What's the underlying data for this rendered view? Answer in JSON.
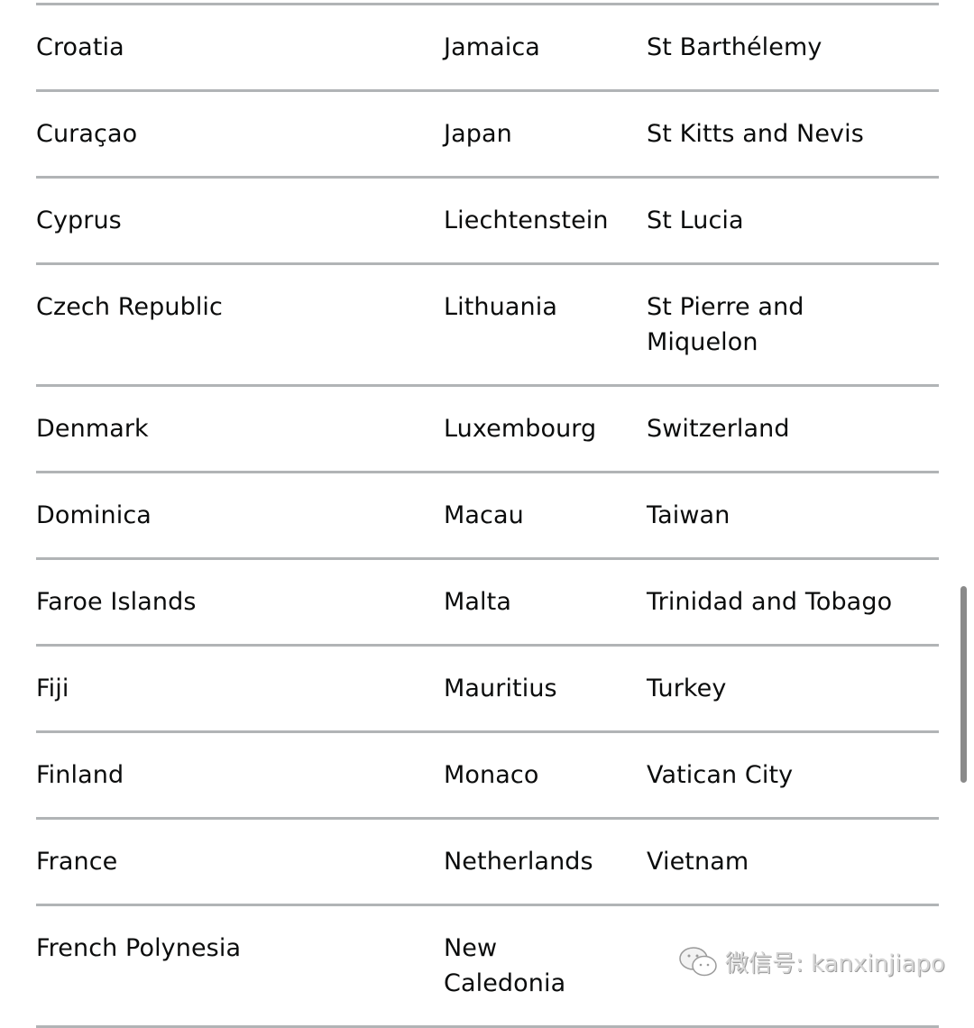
{
  "table": {
    "rows": [
      [
        "Croatia",
        "Jamaica",
        "St Barthélemy"
      ],
      [
        "Curaçao",
        "Japan",
        "St Kitts and Nevis"
      ],
      [
        "Cyprus",
        "Liechtenstein",
        "St Lucia"
      ],
      [
        "Czech Republic",
        "Lithuania",
        "St Pierre and Miquelon"
      ],
      [
        "Denmark",
        "Luxembourg",
        "Switzerland"
      ],
      [
        "Dominica",
        "Macau",
        "Taiwan"
      ],
      [
        "Faroe Islands",
        "Malta",
        "Trinidad and Tobago"
      ],
      [
        "Fiji",
        "Mauritius",
        "Turkey"
      ],
      [
        "Finland",
        "Monaco",
        "Vatican City"
      ],
      [
        "France",
        "Netherlands",
        "Vietnam"
      ],
      [
        "French Polynesia",
        "New Caledonia",
        ""
      ]
    ]
  },
  "watermark": {
    "icon": "wechat-icon",
    "text": "微信号: kanxinjiapo"
  }
}
